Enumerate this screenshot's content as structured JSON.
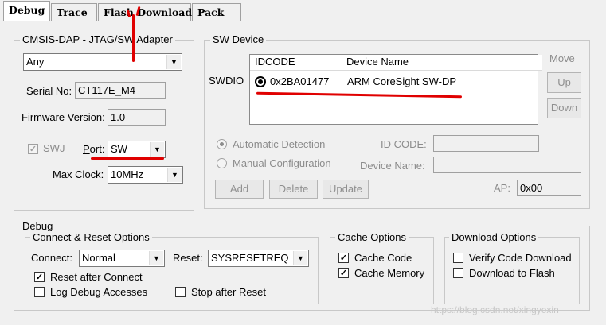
{
  "tabs": [
    "Debug",
    "Trace",
    "Flash Download",
    "Pack"
  ],
  "adapter": {
    "title": "CMSIS-DAP - JTAG/SW Adapter",
    "selected": "Any",
    "serial_label": "Serial No:",
    "serial_value": "CT117E_M4",
    "firmware_label": "Firmware Version:",
    "firmware_value": "1.0",
    "swj_label": "SWJ",
    "swj_checked": true,
    "port_label": "Port:",
    "port_value": "SW",
    "clock_label": "Max Clock:",
    "clock_value": "10MHz"
  },
  "sw_device": {
    "title": "SW Device",
    "row_label": "SWDIO",
    "columns": [
      "IDCODE",
      "Device Name"
    ],
    "rows": [
      {
        "idcode": "0x2BA01477",
        "device_name": "ARM CoreSight SW-DP"
      }
    ],
    "move_label": "Move",
    "up_label": "Up",
    "down_label": "Down",
    "auto_detect_label": "Automatic Detection",
    "manual_config_label": "Manual Configuration",
    "id_code_label": "ID CODE:",
    "device_name_label": "Device Name:",
    "add_label": "Add",
    "delete_label": "Delete",
    "update_label": "Update",
    "ap_label": "AP:",
    "ap_value": "0x00"
  },
  "debug": {
    "title": "Debug",
    "connect_reset": {
      "title": "Connect & Reset Options",
      "connect_label": "Connect:",
      "connect_value": "Normal",
      "reset_label": "Reset:",
      "reset_value": "SYSRESETREQ",
      "reset_after_connect": "Reset after Connect",
      "log_debug": "Log Debug Accesses",
      "stop_after_reset": "Stop after Reset"
    },
    "cache": {
      "title": "Cache Options",
      "cache_code": "Cache Code",
      "cache_memory": "Cache Memory"
    },
    "download": {
      "title": "Download Options",
      "verify": "Verify Code Download",
      "download_flash": "Download to Flash"
    }
  },
  "watermark": "https://blog.csdn.net/xingyexin",
  "annotation_color": "#e00000"
}
